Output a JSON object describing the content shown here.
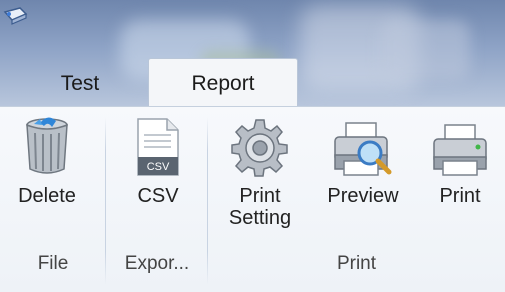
{
  "tabs": [
    {
      "label": "Test",
      "active": false
    },
    {
      "label": "Report",
      "active": true
    }
  ],
  "buttons": {
    "delete": "Delete",
    "csv": "CSV",
    "print_setting_line1": "Print",
    "print_setting_line2": "Setting",
    "preview": "Preview",
    "print": "Print"
  },
  "csv_badge": "CSV",
  "groups": {
    "file": "File",
    "export": "Expor...",
    "print": "Print"
  },
  "colors": {
    "accent": "#5f7fae",
    "tab_active_bg": "#f4f6f9"
  }
}
